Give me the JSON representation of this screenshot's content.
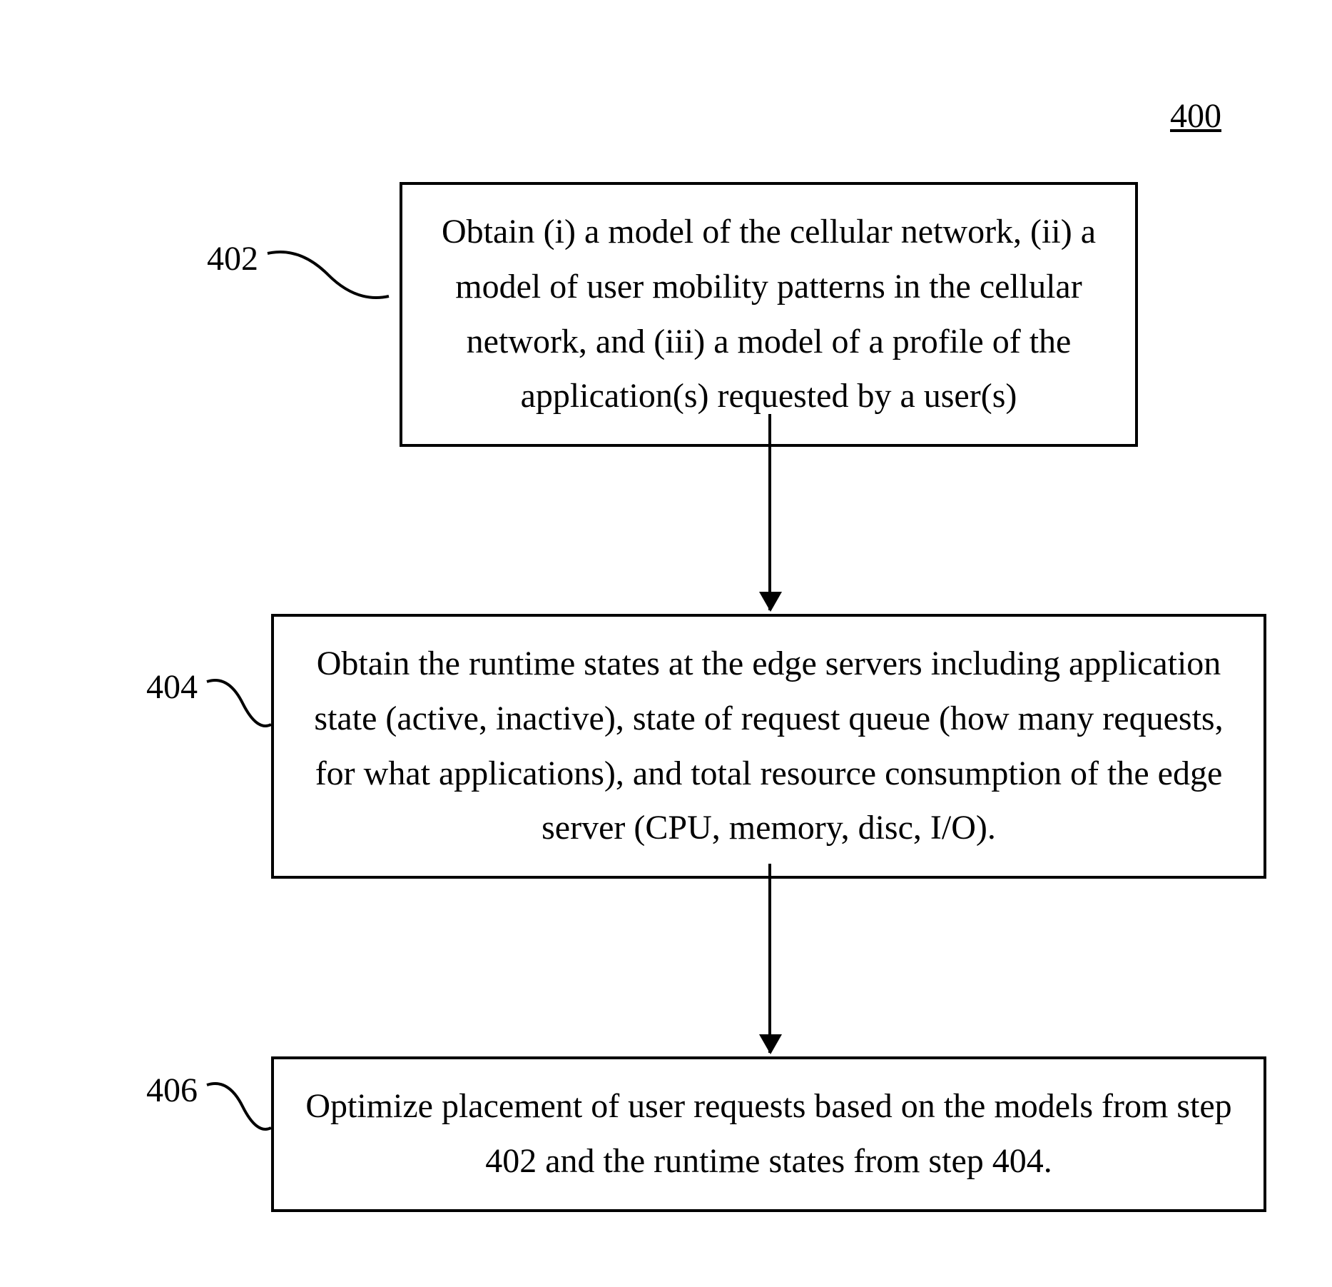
{
  "figure_number": "400",
  "steps": {
    "s402": {
      "label": "402",
      "text": "Obtain (i) a model of the cellular network, (ii) a model of user mobility patterns in the cellular network, and (iii) a model of a profile of the application(s) requested by a user(s)"
    },
    "s404": {
      "label": "404",
      "text": "Obtain the runtime states at the edge servers including application state (active, inactive), state of request queue (how many requests, for what applications), and total resource consumption of the edge server (CPU, memory, disc, I/O)."
    },
    "s406": {
      "label": "406",
      "text": "Optimize placement of user requests based on the models from step 402 and the runtime states from step 404."
    }
  },
  "chart_data": {
    "type": "flowchart",
    "nodes": [
      {
        "id": "402",
        "text": "Obtain (i) a model of the cellular network, (ii) a model of user mobility patterns in the cellular network, and (iii) a model of a profile of the application(s) requested by a user(s)"
      },
      {
        "id": "404",
        "text": "Obtain the runtime states at the edge servers including application state (active, inactive), state of request queue (how many requests, for what applications), and total resource consumption of the edge server (CPU, memory, disc, I/O)."
      },
      {
        "id": "406",
        "text": "Optimize placement of user requests based on the models from step 402 and the runtime states from step 404."
      }
    ],
    "edges": [
      {
        "from": "402",
        "to": "404"
      },
      {
        "from": "404",
        "to": "406"
      }
    ],
    "title": "400"
  }
}
